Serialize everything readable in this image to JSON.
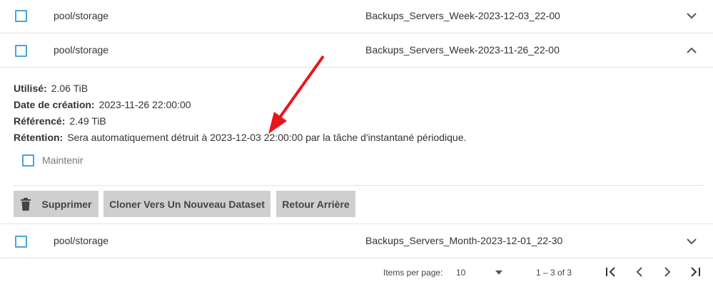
{
  "rows": [
    {
      "dataset": "pool/storage",
      "snapshot": "Backups_Servers_Week-2023-12-03_22-00"
    },
    {
      "dataset": "pool/storage",
      "snapshot": "Backups_Servers_Week-2023-11-26_22-00"
    },
    {
      "dataset": "pool/storage",
      "snapshot": "Backups_Servers_Month-2023-12-01_22-30"
    }
  ],
  "details": {
    "used_label": "Utilisé:",
    "used_value": "2.06 TiB",
    "created_label": "Date de création:",
    "created_value": "2023-11-26 22:00:00",
    "referenced_label": "Référencé:",
    "referenced_value": "2.49 TiB",
    "retention_label": "Rétention:",
    "retention_value": "Sera automatiquement détruit à 2023-12-03 22:00:00 par la tâche d'instantané périodique.",
    "hold_label": "Maintenir"
  },
  "actions": {
    "delete": "Supprimer",
    "clone": "Cloner Vers Un Nouveau Dataset",
    "rollback": "Retour Arrière"
  },
  "pager": {
    "items_per_page_label": "Items per page:",
    "items_per_page_value": "10",
    "range": "1 – 3 of 3"
  },
  "colors": {
    "checkbox_border": "#4ba3d9",
    "button_bg": "#cfcfcf",
    "annotation_arrow": "#e8151b"
  }
}
